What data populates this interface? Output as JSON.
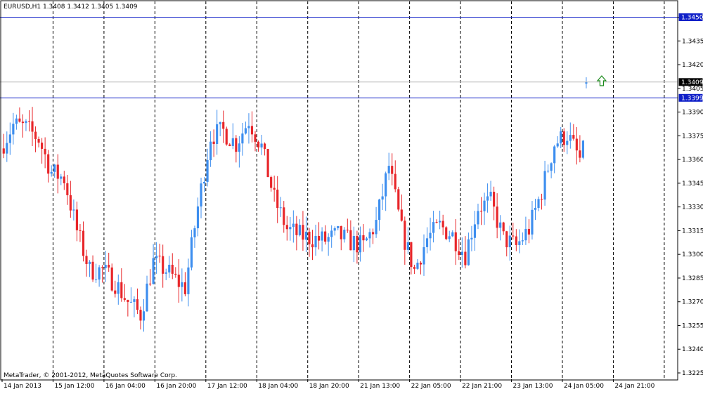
{
  "header": {
    "symbol_label": "EURUSD,H1  1.3408 1.3412 1.3405 1.3409"
  },
  "footer": {
    "copyright": "MetaTrader, © 2001-2012, MetaQuotes Software Corp."
  },
  "colors": {
    "bull": "#3d8eef",
    "bear": "#e8262a",
    "level_line": "#1020c8",
    "bid_line": "#b8b8b8",
    "arrow": "#1a8a1a"
  },
  "icons": {
    "buy_arrow": "up-arrow-icon"
  },
  "chart_data": {
    "type": "candlestick",
    "symbol": "EURUSD",
    "timeframe": "H1",
    "ohlc_last": {
      "open": 1.3408,
      "high": 1.3412,
      "low": 1.3405,
      "close": 1.3409
    },
    "y_ticks": [
      1.345,
      1.3435,
      1.342,
      1.3405,
      1.339,
      1.3375,
      1.336,
      1.3345,
      1.333,
      1.3315,
      1.33,
      1.3285,
      1.327,
      1.3255,
      1.324,
      1.3225
    ],
    "x_labels": [
      "14 Jan 2013",
      "15 Jan 12:00",
      "16 Jan 04:00",
      "16 Jan 20:00",
      "17 Jan 12:00",
      "18 Jan 04:00",
      "18 Jan 20:00",
      "21 Jan 13:00",
      "22 Jan 05:00",
      "22 Jan 21:00",
      "23 Jan 13:00",
      "24 Jan 05:00",
      "24 Jan 21:00"
    ],
    "ylim": [
      1.3221,
      1.346
    ],
    "current_price": 1.3409,
    "levels": [
      1.345,
      1.3399
    ],
    "bar_count": 184,
    "anchors": [
      [
        0,
        1.3367
      ],
      [
        4,
        1.3382
      ],
      [
        8,
        1.338
      ],
      [
        12,
        1.3373
      ],
      [
        16,
        1.3352
      ],
      [
        20,
        1.3348
      ],
      [
        24,
        1.3315
      ],
      [
        28,
        1.329
      ],
      [
        32,
        1.329
      ],
      [
        36,
        1.3282
      ],
      [
        40,
        1.327
      ],
      [
        44,
        1.3262
      ],
      [
        48,
        1.3295
      ],
      [
        52,
        1.329
      ],
      [
        56,
        1.3282
      ],
      [
        58,
        1.3279
      ],
      [
        62,
        1.333
      ],
      [
        66,
        1.3375
      ],
      [
        70,
        1.3378
      ],
      [
        74,
        1.337
      ],
      [
        78,
        1.3385
      ],
      [
        82,
        1.3368
      ],
      [
        86,
        1.3335
      ],
      [
        90,
        1.3316
      ],
      [
        94,
        1.3312
      ],
      [
        98,
        1.331
      ],
      [
        102,
        1.3309
      ],
      [
        106,
        1.3312
      ],
      [
        110,
        1.3308
      ],
      [
        114,
        1.3305
      ],
      [
        118,
        1.332
      ],
      [
        122,
        1.3356
      ],
      [
        126,
        1.3315
      ],
      [
        130,
        1.329
      ],
      [
        134,
        1.331
      ],
      [
        138,
        1.3318
      ],
      [
        142,
        1.3312
      ],
      [
        146,
        1.33
      ],
      [
        150,
        1.333
      ],
      [
        154,
        1.3333
      ],
      [
        158,
        1.331
      ],
      [
        162,
        1.3305
      ],
      [
        166,
        1.3316
      ],
      [
        170,
        1.334
      ],
      [
        174,
        1.337
      ],
      [
        178,
        1.3376
      ],
      [
        182,
        1.336
      ],
      [
        184,
        1.337
      ],
      [
        186,
        1.341
      ]
    ]
  }
}
